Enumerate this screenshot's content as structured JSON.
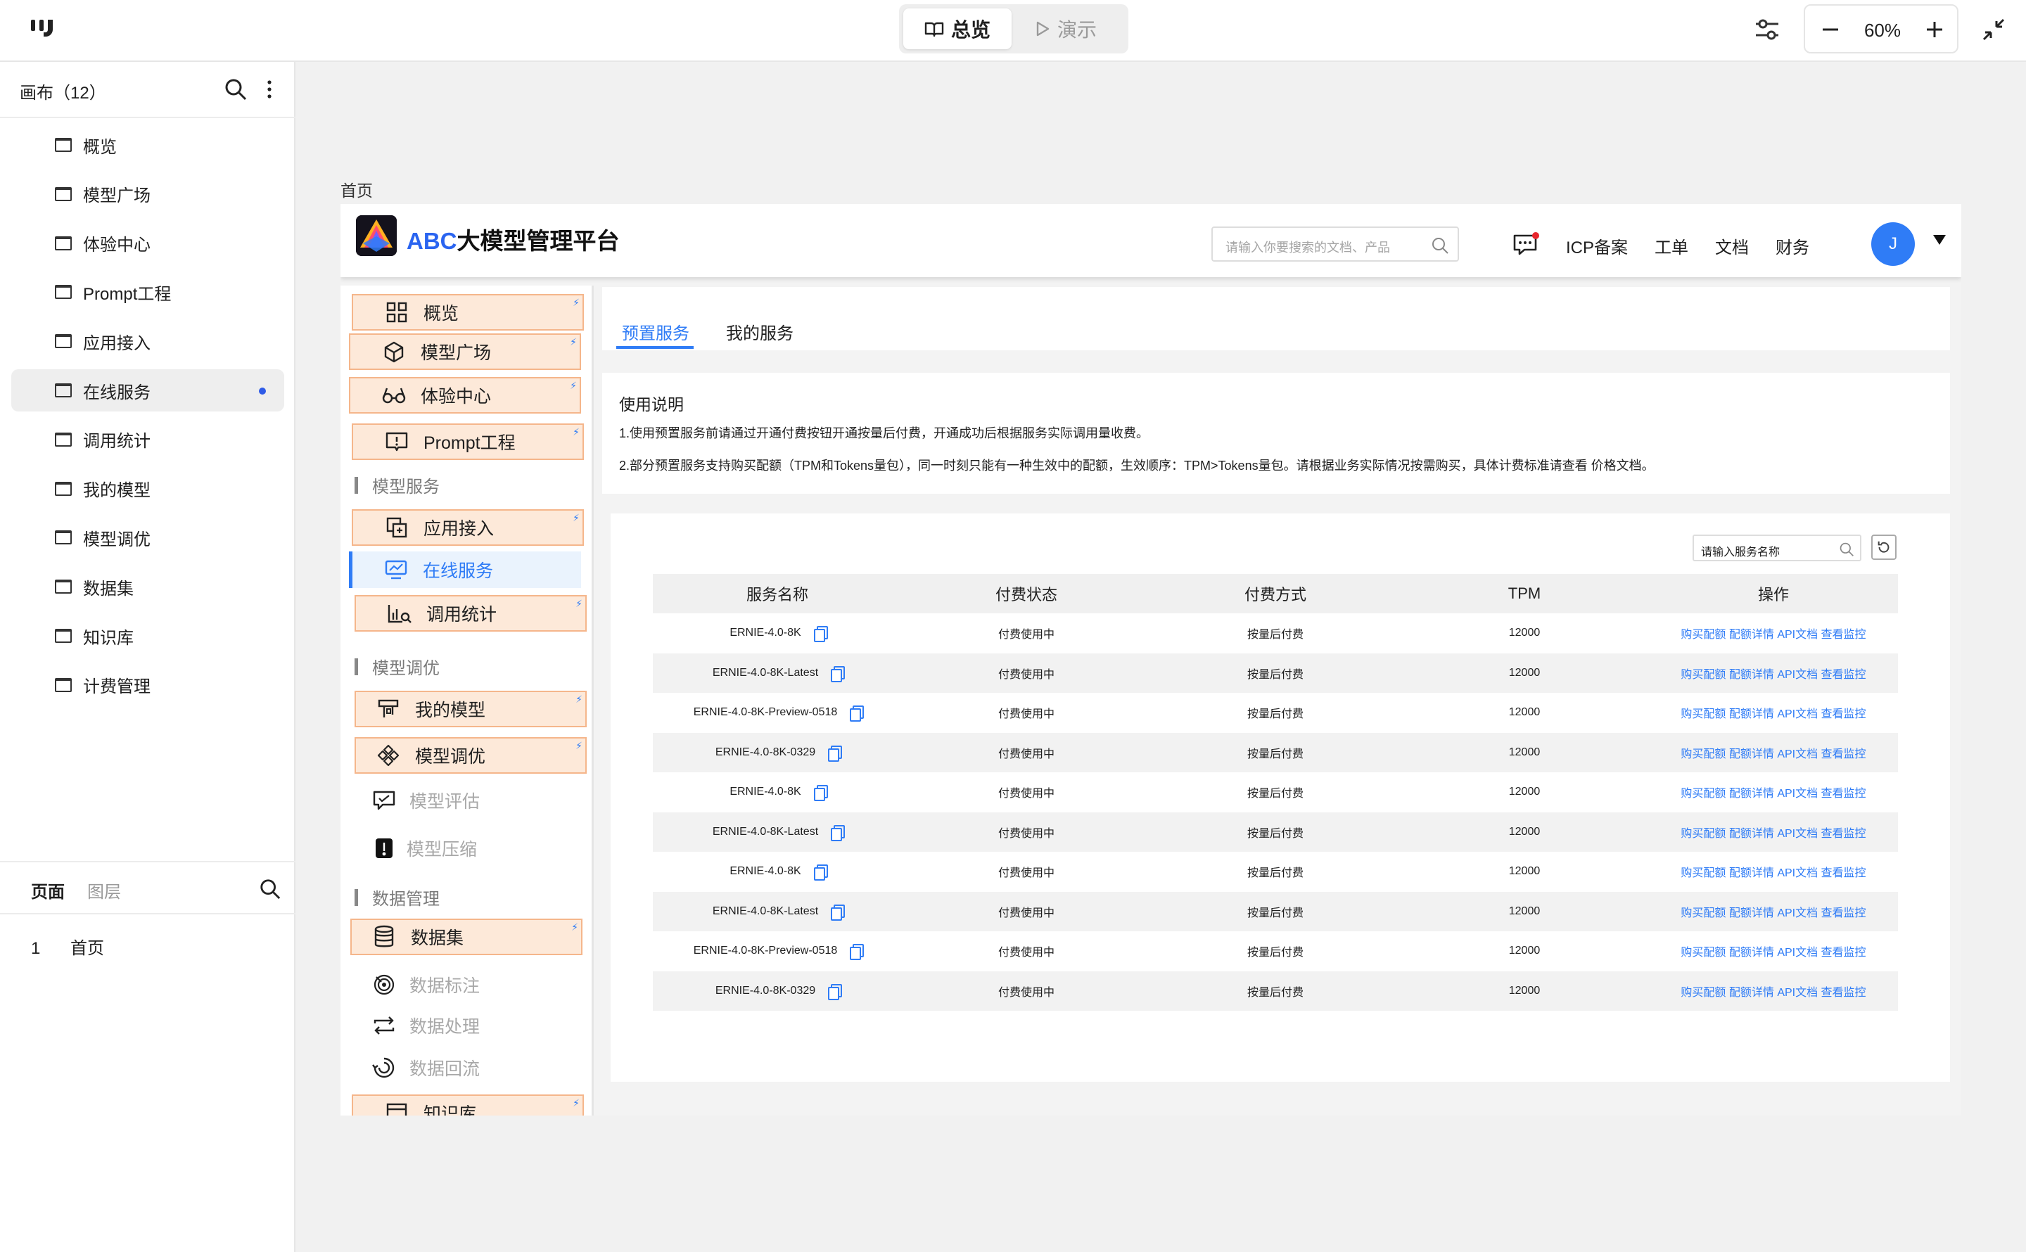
{
  "topbar": {
    "mode_overview": "总览",
    "mode_present": "演示",
    "zoom": "60%"
  },
  "left_panel": {
    "header": "画布（12）",
    "canvases": [
      "概览",
      "模型广场",
      "体验中心",
      "Prompt工程",
      "应用接入",
      "在线服务",
      "调用统计",
      "我的模型",
      "模型调优",
      "数据集",
      "知识库",
      "计费管理"
    ],
    "selected_index": 5,
    "tab_pages": "页面",
    "tab_layers": "图层",
    "page_number": "1",
    "page_name": "首页"
  },
  "canvas": {
    "page_label": "首页",
    "app": {
      "title_prefix": "ABC",
      "title_rest": "大模型管理平台",
      "search_placeholder": "请输入你要搜索的文档、产品",
      "links": [
        "ICP备案",
        "工单",
        "文档",
        "财务"
      ],
      "avatar_initial": "J"
    },
    "sidebar": {
      "items_top": [
        {
          "label": "概览",
          "icon": "grid-icon"
        },
        {
          "label": "模型广场",
          "icon": "cube-icon"
        },
        {
          "label": "体验中心",
          "icon": "glasses-icon"
        },
        {
          "label": "Prompt工程",
          "icon": "prompt-icon"
        }
      ],
      "section_model_service": "模型服务",
      "items_service": [
        {
          "label": "应用接入",
          "icon": "app-access-icon"
        },
        {
          "label": "在线服务",
          "icon": "online-service-icon"
        },
        {
          "label": "调用统计",
          "icon": "stats-icon"
        }
      ],
      "section_tuning": "模型调优",
      "items_tuning": [
        {
          "label": "我的模型",
          "icon": "model-icon"
        },
        {
          "label": "模型调优",
          "icon": "tuning-icon"
        }
      ],
      "items_tuning_disabled": [
        {
          "label": "模型评估",
          "icon": "eval-icon"
        },
        {
          "label": "模型压缩",
          "icon": "compress-icon"
        }
      ],
      "section_data": "数据管理",
      "items_data": [
        {
          "label": "数据集",
          "icon": "database-icon"
        }
      ],
      "items_data_disabled": [
        {
          "label": "数据标注",
          "icon": "annotate-icon"
        },
        {
          "label": "数据处理",
          "icon": "process-icon"
        },
        {
          "label": "数据回流",
          "icon": "reflow-icon"
        }
      ],
      "item_knowledge": "知识库"
    },
    "tabs": [
      "预置服务",
      "我的服务"
    ],
    "usage": {
      "title": "使用说明",
      "line1": "1.使用预置服务前请通过开通付费按钮开通按量后付费，开通成功后根据服务实际调用量收费。",
      "line2": "2.部分预置服务支持购买配额（TPM和Tokens量包），同一时刻只能有一种生效中的配额，生效顺序：TPM>Tokens量包。请根据业务实际情况按需购买，具体计费标准请查看 价格文档。"
    },
    "table": {
      "search_placeholder": "请输入服务名称",
      "columns": [
        "服务名称",
        "付费状态",
        "付费方式",
        "TPM",
        "操作"
      ],
      "rows": [
        {
          "name": "ERNIE-4.0-8K",
          "status": "付费使用中",
          "method": "按量后付费",
          "tpm": "12000"
        },
        {
          "name": "ERNIE-4.0-8K-Latest",
          "status": "付费使用中",
          "method": "按量后付费",
          "tpm": "12000"
        },
        {
          "name": "ERNIE-4.0-8K-Preview-0518",
          "status": "付费使用中",
          "method": "按量后付费",
          "tpm": "12000"
        },
        {
          "name": "ERNIE-4.0-8K-0329",
          "status": "付费使用中",
          "method": "按量后付费",
          "tpm": "12000"
        },
        {
          "name": "ERNIE-4.0-8K",
          "status": "付费使用中",
          "method": "按量后付费",
          "tpm": "12000"
        },
        {
          "name": "ERNIE-4.0-8K-Latest",
          "status": "付费使用中",
          "method": "按量后付费",
          "tpm": "12000"
        },
        {
          "name": "ERNIE-4.0-8K",
          "status": "付费使用中",
          "method": "按量后付费",
          "tpm": "12000"
        },
        {
          "name": "ERNIE-4.0-8K-Latest",
          "status": "付费使用中",
          "method": "按量后付费",
          "tpm": "12000"
        },
        {
          "name": "ERNIE-4.0-8K-Preview-0518",
          "status": "付费使用中",
          "method": "按量后付费",
          "tpm": "12000"
        },
        {
          "name": "ERNIE-4.0-8K-0329",
          "status": "付费使用中",
          "method": "按量后付费",
          "tpm": "12000"
        }
      ],
      "ops": "购买配额 配额详情 API文档 查看监控"
    }
  },
  "colors": {
    "accent": "#2f7cf6",
    "nav_highlight_bg": "#fde9d9",
    "nav_highlight_border": "#f5b68b",
    "selected_dot": "#2f5be7"
  }
}
